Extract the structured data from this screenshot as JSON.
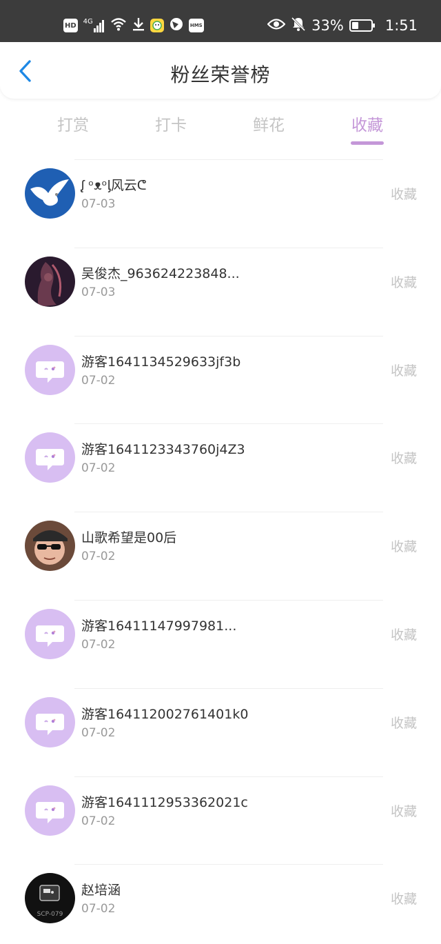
{
  "status_bar": {
    "hd": "HD",
    "net": "4G",
    "battery_pct": "33%",
    "time": "1:51",
    "icons": [
      "hd-icon",
      "signal-icon",
      "wifi-icon",
      "download-icon",
      "app-icon",
      "browser-icon",
      "hms-icon",
      "eye-icon",
      "bell-off-icon",
      "battery-icon"
    ],
    "hms_label": "HMS"
  },
  "header": {
    "title": "粉丝荣誉榜",
    "back_icon": "chevron-left-icon",
    "accent": "#1e88e5"
  },
  "tabs": [
    {
      "label": "打赏"
    },
    {
      "label": "打卡"
    },
    {
      "label": "鲜花"
    },
    {
      "label": "收藏",
      "active": true
    }
  ],
  "colors": {
    "active": "#c497d8",
    "inactive": "#c4c4c4",
    "guest_avatar": "#d8bef2"
  },
  "items": [
    {
      "name": "ᶘ ᵒᴥᵒᶅ风云ᕦ",
      "date": "07-03",
      "action": "收藏",
      "avatar": "dove-photo"
    },
    {
      "name": "吴俊杰_963624223848...",
      "date": "07-03",
      "action": "收藏",
      "avatar": "dark-art-photo"
    },
    {
      "name": "游客1641134529633jf3b",
      "date": "07-02",
      "action": "收藏",
      "avatar": "guest-chat-icon"
    },
    {
      "name": "游客1641123343760j4Z3",
      "date": "07-02",
      "action": "收藏",
      "avatar": "guest-chat-icon"
    },
    {
      "name": "山歌希望是00后",
      "date": "07-02",
      "action": "收藏",
      "avatar": "person-photo"
    },
    {
      "name": "游客16411147997981...",
      "date": "07-02",
      "action": "收藏",
      "avatar": "guest-chat-icon"
    },
    {
      "name": "游客164112002761401k0",
      "date": "07-02",
      "action": "收藏",
      "avatar": "guest-chat-icon"
    },
    {
      "name": "游客1641112953362021c",
      "date": "07-02",
      "action": "收藏",
      "avatar": "guest-chat-icon"
    },
    {
      "name": "赵培涵",
      "date": "07-02",
      "action": "收藏",
      "avatar": "scp-logo",
      "avatar_text": "SCP-079"
    }
  ]
}
